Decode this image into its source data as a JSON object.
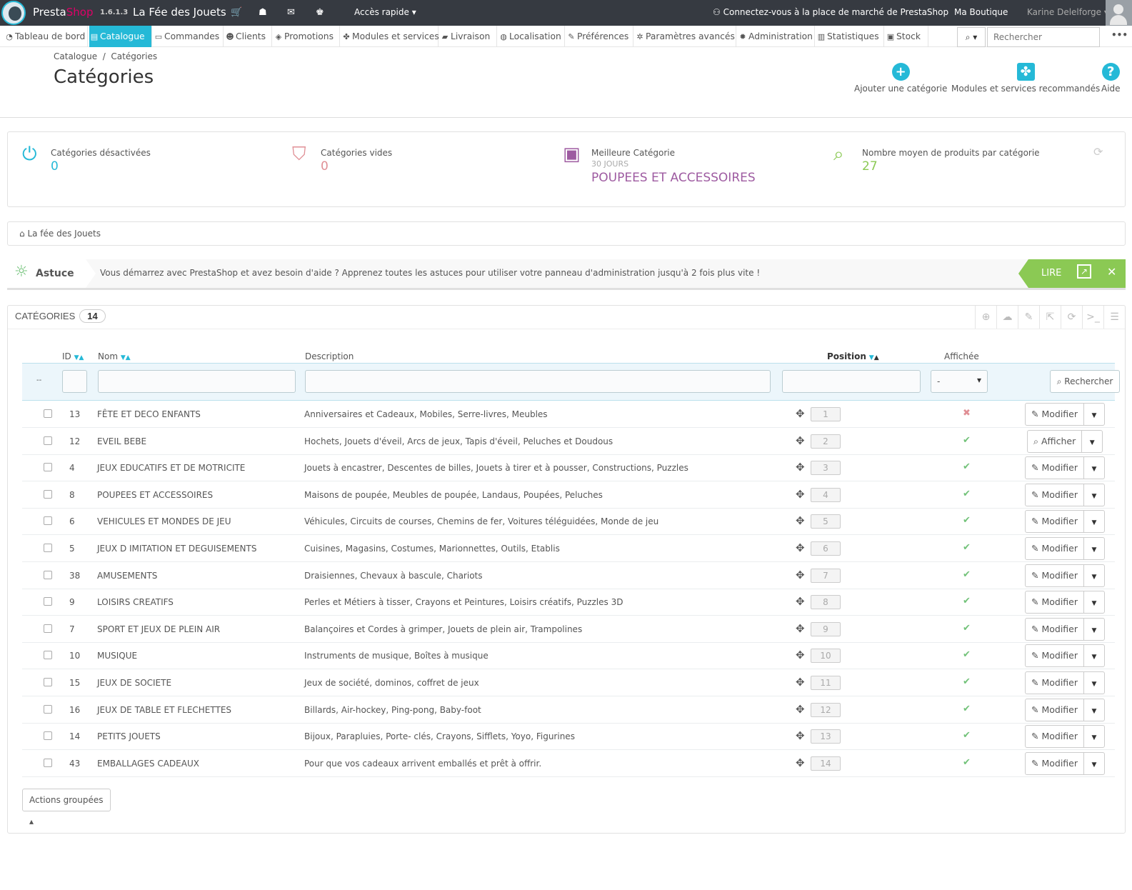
{
  "topbar": {
    "brand_1": "Presta",
    "brand_2": "Shop",
    "version": "1.6.1.3",
    "shop_name": "La Fée des Jouets",
    "quick_access": "Accès rapide",
    "marketplace": "Connectez-vous à la place de marché de PrestaShop",
    "my_shop": "Ma Boutique",
    "user": "Karine Delelforge"
  },
  "nav": [
    {
      "label": "Tableau de bord",
      "icon": "dashboard-icon",
      "glyph": "◔"
    },
    {
      "label": "Catalogue",
      "icon": "catalog-icon",
      "glyph": "▤"
    },
    {
      "label": "Commandes",
      "icon": "orders-icon",
      "glyph": "▭"
    },
    {
      "label": "Clients",
      "icon": "clients-icon",
      "glyph": "☻"
    },
    {
      "label": "Promotions",
      "icon": "promotions-icon",
      "glyph": "◈"
    },
    {
      "label": "Modules et services",
      "icon": "modules-icon",
      "glyph": "✤"
    },
    {
      "label": "Livraison",
      "icon": "truck-icon",
      "glyph": "▰"
    },
    {
      "label": "Localisation",
      "icon": "globe-icon",
      "glyph": "◍"
    },
    {
      "label": "Préférences",
      "icon": "wrench-icon",
      "glyph": "✎"
    },
    {
      "label": "Paramètres avancés",
      "icon": "cogs-icon",
      "glyph": "✲"
    },
    {
      "label": "Administration",
      "icon": "gear-icon",
      "glyph": "✹"
    },
    {
      "label": "Statistiques",
      "icon": "bar-chart-icon",
      "glyph": "▥"
    },
    {
      "label": "Stock",
      "icon": "stock-icon",
      "glyph": "▣"
    }
  ],
  "search": {
    "placeholder": "Rechercher"
  },
  "breadcrumb": {
    "parent": "Catalogue",
    "separator": "/",
    "current": "Catégories"
  },
  "page_title": "Catégories",
  "toolbar": {
    "add": "Ajouter une catégorie",
    "modules": "Modules et services recommandés",
    "help": "Aide"
  },
  "kpis": [
    {
      "label": "Catégories désactivées",
      "sub": "",
      "value": "0",
      "color": "#25b9d7",
      "icon": "power-icon"
    },
    {
      "label": "Catégories vides",
      "sub": "",
      "value": "0",
      "color": "#e08f95",
      "icon": "bookmark-icon"
    },
    {
      "label": "Meilleure Catégorie",
      "sub": "30 JOURS",
      "value": "POUPEES ET ACCESSOIRES",
      "color": "#9e5ba1",
      "icon": "money-icon"
    },
    {
      "label": "Nombre moyen de produits par catégorie",
      "sub": "",
      "value": "27",
      "color": "#8bc954",
      "icon": "search-icon"
    }
  ],
  "shop_tree": "La fée des Jouets",
  "tip": {
    "title": "Astuce",
    "text": "Vous démarrez avec PrestaShop et avez besoin d'aide ? Apprenez toutes les astuces pour utiliser votre panneau d'administration jusqu'à 2 fois plus vite !",
    "read": "LIRE"
  },
  "table": {
    "title": "CATÉGORIES",
    "count": "14",
    "headers": {
      "id": "ID",
      "name": "Nom",
      "description": "Description",
      "position": "Position",
      "displayed": "Affichée"
    },
    "filter": {
      "dash": "--",
      "select_value": "-",
      "search": "Rechercher"
    },
    "rows": [
      {
        "id": "13",
        "name": "FÊTE ET DECO ENFANTS",
        "description": "Anniversaires et Cadeaux, Mobiles, Serre-livres, Meubles",
        "position": "1",
        "active": false,
        "action": "Modifier"
      },
      {
        "id": "12",
        "name": "EVEIL BEBE",
        "description": "Hochets, Jouets d'éveil, Arcs de jeux, Tapis d'éveil, Peluches et Doudous",
        "position": "2",
        "active": true,
        "action": "Afficher"
      },
      {
        "id": "4",
        "name": "JEUX EDUCATIFS ET DE MOTRICITE",
        "description": "Jouets à encastrer, Descentes de billes, Jouets à tirer et à pousser, Constructions, Puzzles",
        "position": "3",
        "active": true,
        "action": "Modifier"
      },
      {
        "id": "8",
        "name": "POUPEES ET ACCESSOIRES",
        "description": "Maisons de poupée, Meubles de poupée, Landaus, Poupées, Peluches",
        "position": "4",
        "active": true,
        "action": "Modifier"
      },
      {
        "id": "6",
        "name": "VEHICULES ET MONDES DE JEU",
        "description": "Véhicules, Circuits de courses, Chemins de fer, Voitures téléguidées, Monde de jeu",
        "position": "5",
        "active": true,
        "action": "Modifier"
      },
      {
        "id": "5",
        "name": "JEUX D IMITATION ET DEGUISEMENTS",
        "description": "Cuisines, Magasins, Costumes, Marionnettes, Outils, Etablis",
        "position": "6",
        "active": true,
        "action": "Modifier"
      },
      {
        "id": "38",
        "name": "AMUSEMENTS",
        "description": "Draisiennes, Chevaux à bascule, Chariots",
        "position": "7",
        "active": true,
        "action": "Modifier"
      },
      {
        "id": "9",
        "name": "LOISIRS CREATIFS",
        "description": "Perles et Métiers à tisser, Crayons et Peintures, Loisirs créatifs, Puzzles 3D",
        "position": "8",
        "active": true,
        "action": "Modifier"
      },
      {
        "id": "7",
        "name": "SPORT ET JEUX DE PLEIN AIR",
        "description": "Balançoires et Cordes à grimper, Jouets de plein air, Trampolines",
        "position": "9",
        "active": true,
        "action": "Modifier"
      },
      {
        "id": "10",
        "name": "MUSIQUE",
        "description": "Instruments de musique, Boîtes à musique",
        "position": "10",
        "active": true,
        "action": "Modifier"
      },
      {
        "id": "15",
        "name": "JEUX DE SOCIETE",
        "description": "Jeux de société, dominos, coffret de jeux",
        "position": "11",
        "active": true,
        "action": "Modifier"
      },
      {
        "id": "16",
        "name": "JEUX DE TABLE ET FLECHETTES",
        "description": "Billards, Air-hockey, Ping-pong, Baby-foot",
        "position": "12",
        "active": true,
        "action": "Modifier"
      },
      {
        "id": "14",
        "name": "PETITS JOUETS",
        "description": "Bijoux, Parapluies, Porte- clés, Crayons, Sifflets, Yoyo, Figurines",
        "position": "13",
        "active": true,
        "action": "Modifier"
      },
      {
        "id": "43",
        "name": "EMBALLAGES CADEAUX",
        "description": "Pour que vos cadeaux arrivent emballés et prêt à offrir.",
        "position": "14",
        "active": true,
        "action": "Modifier"
      }
    ],
    "bulk_actions": "Actions groupées"
  },
  "colors": {
    "accent": "#25b9d7",
    "topbar": "#363a41",
    "success": "#72c279",
    "danger": "#e08f95"
  }
}
